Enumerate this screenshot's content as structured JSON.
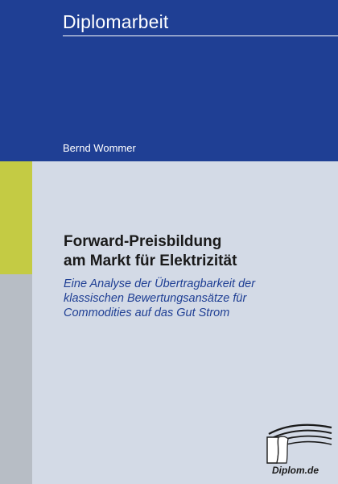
{
  "cover": {
    "series": "Diplomarbeit",
    "author": "Bernd Wommer",
    "title_lines": [
      "Forward-Preisbildung",
      "am Markt für Elektrizität"
    ],
    "subtitle_lines": [
      "Eine Analyse der Übertragbarkeit der",
      "klassischen Bewertungsansätze für",
      "Commodities auf das Gut Strom"
    ],
    "publisher": "Diplom.de",
    "colors": {
      "top_band": "#1f3f94",
      "background": "#d3dae6",
      "accent_olive": "#c4cb44",
      "accent_gray": "#b7bdc5",
      "subtitle_text": "#1f3f94",
      "title_text": "#1a1a1a"
    }
  }
}
